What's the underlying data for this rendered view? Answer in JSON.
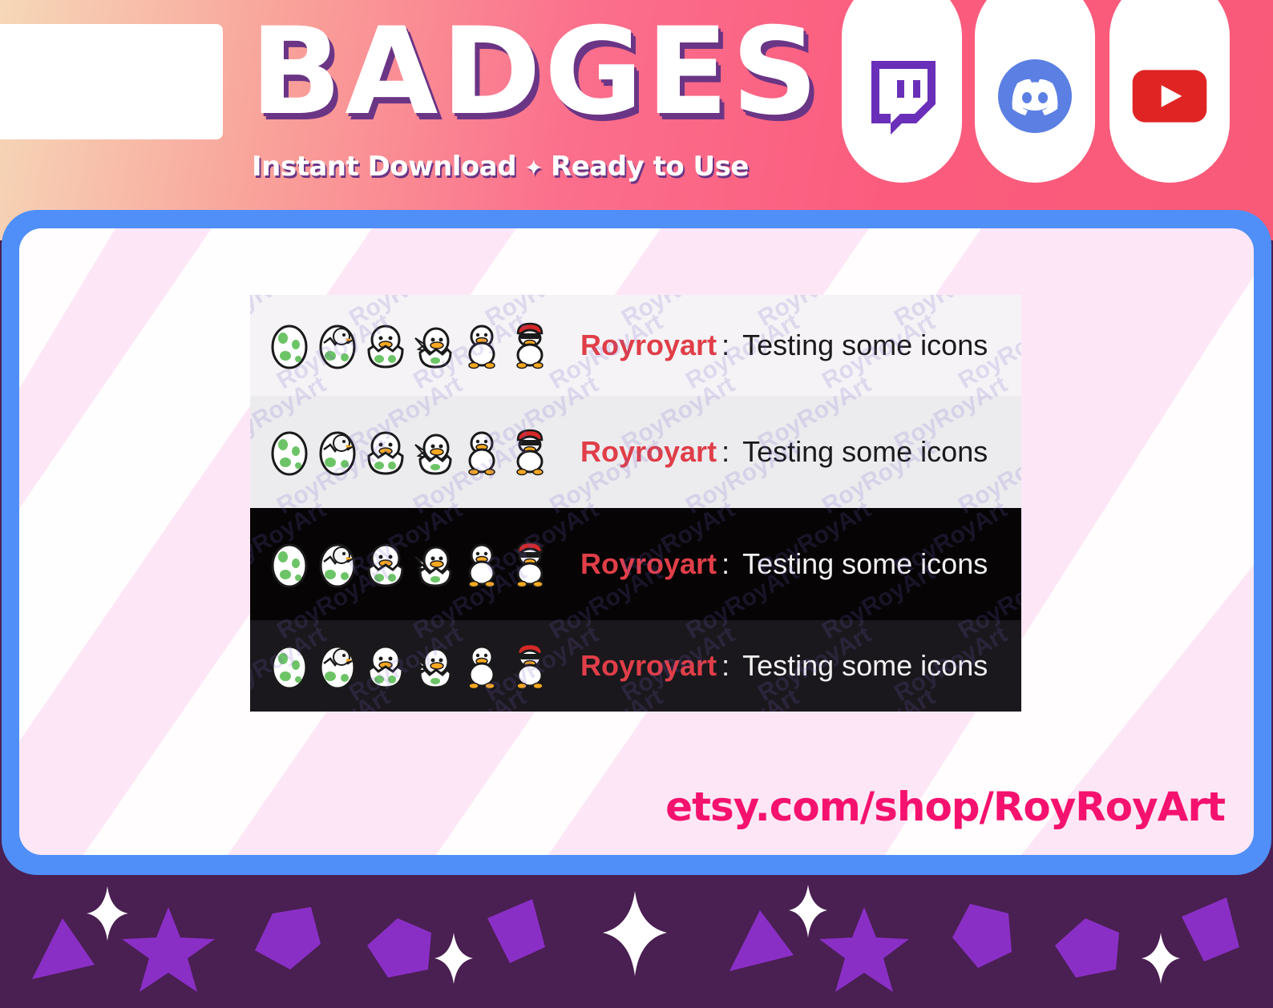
{
  "header": {
    "title": "BADGES",
    "subtitle_left": "Instant Download",
    "subtitle_sep": "✦",
    "subtitle_right": "Ready to Use",
    "platform_icons": [
      "twitch-icon",
      "discord-icon",
      "youtube-icon"
    ]
  },
  "chat_preview": {
    "rows": [
      {
        "theme": "light",
        "username": "Royroyart",
        "separator": ":",
        "message": "Testing some icons"
      },
      {
        "theme": "light-gray",
        "username": "Royroyart",
        "separator": ":",
        "message": "Testing some icons"
      },
      {
        "theme": "dark",
        "username": "Royroyart",
        "separator": ":",
        "message": "Testing some icons"
      },
      {
        "theme": "dark-gray",
        "username": "Royroyart",
        "separator": ":",
        "message": "Testing some icons"
      }
    ],
    "badge_icons": [
      "egg-icon",
      "cracked-egg-chick-icon",
      "hatching-chick-icon",
      "winged-chick-egg-icon",
      "sitting-chick-icon",
      "cool-chick-cap-sunglasses-icon"
    ],
    "watermark_text": "RoyRoyArt"
  },
  "footer": {
    "shop_url": "etsy.com/shop/RoyRoyArt",
    "decorations": [
      "triangle-shape",
      "sparkle-icon",
      "star-shape",
      "pentagon-shape",
      "pentagon-shape",
      "sparkle-icon",
      "pentagon-shape",
      "sparkle-icon",
      "triangle-shape",
      "sparkle-icon",
      "star-shape",
      "pentagon-shape",
      "pentagon-shape",
      "sparkle-icon",
      "pentagon-shape"
    ]
  },
  "colors": {
    "frame_blue": "#4f8ff7",
    "username_red": "#e03e48",
    "shop_pink": "#f5126e",
    "footer_purple": "#4a1f52",
    "shape_purple": "#8a2fc6",
    "title_shadow": "#6b3585"
  }
}
